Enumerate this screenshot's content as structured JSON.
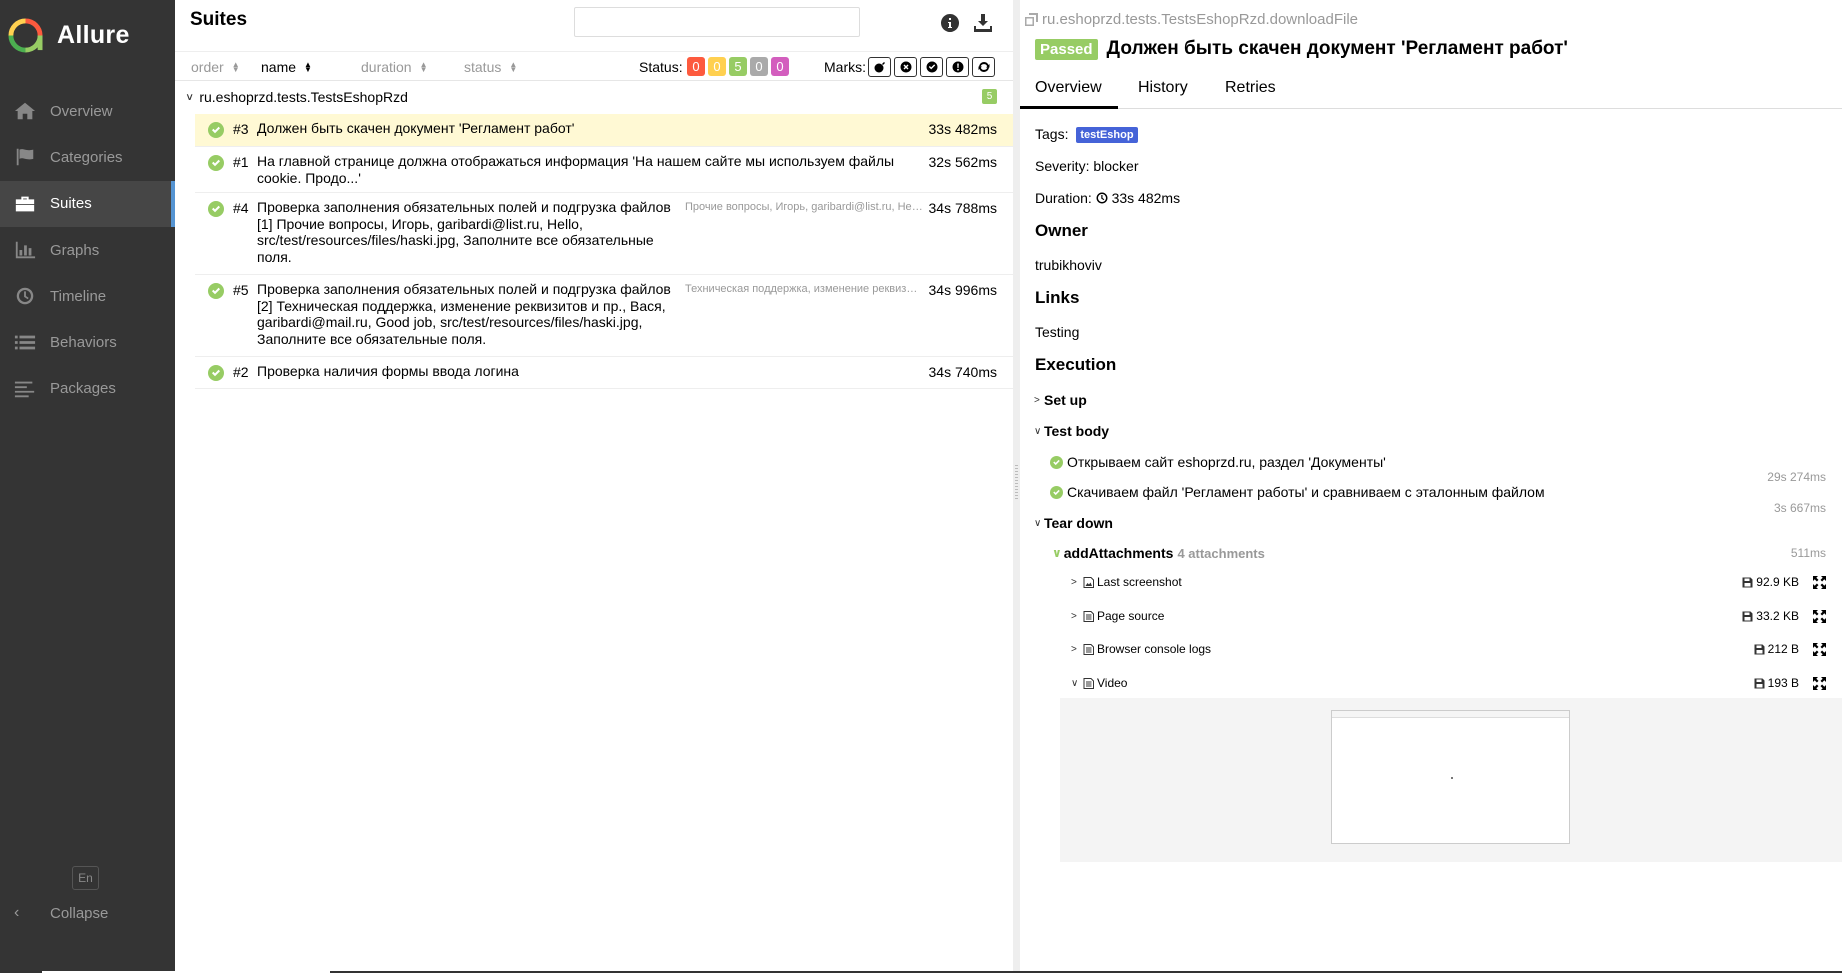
{
  "sidebar": {
    "brand": "Allure",
    "items": [
      {
        "label": "Overview",
        "icon": "home-icon"
      },
      {
        "label": "Categories",
        "icon": "flag-icon"
      },
      {
        "label": "Suites",
        "icon": "briefcase-icon"
      },
      {
        "label": "Graphs",
        "icon": "bar-chart-icon"
      },
      {
        "label": "Timeline",
        "icon": "clock-icon"
      },
      {
        "label": "Behaviors",
        "icon": "list-icon"
      },
      {
        "label": "Packages",
        "icon": "align-left-icon"
      }
    ],
    "active_item": "Suites",
    "language": "En",
    "collapse_label": "Collapse"
  },
  "suites": {
    "title": "Suites",
    "search": {
      "value": "",
      "placeholder": ""
    },
    "sort": {
      "order": "order",
      "name": "name",
      "duration": "duration",
      "status": "status",
      "active": "name"
    },
    "status_label": "Status:",
    "status_counts": [
      {
        "value": "0",
        "color": "#fd5a3e",
        "meaning": "failed"
      },
      {
        "value": "0",
        "color": "#ffd050",
        "meaning": "broken"
      },
      {
        "value": "5",
        "color": "#97cc64",
        "meaning": "passed"
      },
      {
        "value": "0",
        "color": "#aaaaaa",
        "meaning": "skipped"
      },
      {
        "value": "0",
        "color": "#d35ebe",
        "meaning": "unknown"
      }
    ],
    "marks_label": "Marks:",
    "marks": [
      "bomb-icon",
      "times-circle-icon",
      "check-circle-icon",
      "exclamation-circle-icon",
      "refresh-icon"
    ],
    "group": {
      "name": "ru.eshoprzd.tests.TestsEshopRzd",
      "count": "5"
    },
    "tests": [
      {
        "num": "#3",
        "title": "Должен быть скачен документ 'Регламент работ'",
        "params": "",
        "duration": "33s 482ms",
        "selected": true
      },
      {
        "num": "#1",
        "title": "На главной странице должна отображаться информация 'На нашем сайте мы используем файлы cookie. Продо...'",
        "params": "",
        "duration": "32s 562ms",
        "selected": false
      },
      {
        "num": "#4",
        "title": "Проверка заполнения обязательных полей и подгрузка файлов [1] Прочие вопросы, Игорь, garibardi@list.ru, Hello, src/test/resources/files/haski.jpg, Заполните все обязательные поля.",
        "params": "Прочие вопросы, Игорь, garibardi@list.ru, Hello, src/test/resources/files/haski.jpg, Заполните все обязательные поля.",
        "duration": "34s 788ms",
        "selected": false
      },
      {
        "num": "#5",
        "title": "Проверка заполнения обязательных полей и подгрузка файлов [2] Техническая поддержка, изменение реквизитов и пр., Вася, garibardi@mail.ru, Good job, src/test/resources/files/haski.jpg, Заполните все обязательные поля.",
        "params": "Техническая поддержка, изменение реквизитов и пр., Вася, garibardi@mail.ru, Good job, src/test/resources/files/haski.jpg, Заполните все обязательные поля.",
        "duration": "34s 996ms",
        "selected": false
      },
      {
        "num": "#2",
        "title": "Проверка наличия формы ввода логина",
        "params": "",
        "duration": "34s 740ms",
        "selected": false
      }
    ]
  },
  "detail": {
    "breadcrumb": "ru.eshoprzd.tests.TestsEshopRzd.downloadFile",
    "status": "Passed",
    "title": "Должен быть скачен документ 'Регламент работ'",
    "tabs": [
      "Overview",
      "History",
      "Retries"
    ],
    "active_tab": "Overview",
    "tags_label": "Tags:",
    "tag": "testEshop",
    "severity": "Severity: blocker",
    "duration_label": "Duration:",
    "duration": "33s 482ms",
    "owner_heading": "Owner",
    "owner": "trubikhoviv",
    "links_heading": "Links",
    "link": "Testing",
    "execution_heading": "Execution",
    "setup_label": "Set up",
    "testbody_label": "Test body",
    "steps": [
      {
        "name": "Открываем сайт eshoprzd.ru, раздел 'Документы'",
        "duration": "29s 274ms"
      },
      {
        "name": "Скачиваем файл 'Регламент работы' и сравниваем с эталонным файлом",
        "duration": "3s 667ms"
      }
    ],
    "teardown_label": "Tear down",
    "attach_group": {
      "name": "addAttachments",
      "count": "4 attachments",
      "duration": "511ms"
    },
    "attachments": [
      {
        "name": "Last screenshot",
        "icon": "image-file-icon",
        "size": "92.9 KB",
        "expanded": false
      },
      {
        "name": "Page source",
        "icon": "text-file-icon",
        "size": "33.2 KB",
        "expanded": false
      },
      {
        "name": "Browser console logs",
        "icon": "text-file-icon",
        "size": "212 B",
        "expanded": false
      },
      {
        "name": "Video",
        "icon": "text-file-icon",
        "size": "193 B",
        "expanded": true
      }
    ]
  },
  "colors": {
    "sidebar_bg": "#343434",
    "passed": "#97cc64",
    "selected_row": "#fff9d4",
    "tag": "#4563d8",
    "active_nav_marker": "#5594d2"
  }
}
